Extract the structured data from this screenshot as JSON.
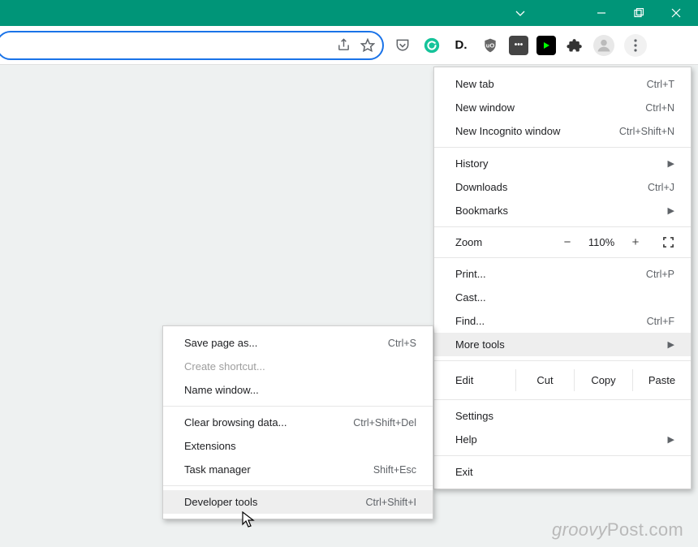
{
  "colors": {
    "accent": "#009578",
    "omnibox_border": "#1a73e8"
  },
  "menu": {
    "new_tab": "New tab",
    "new_tab_sc": "Ctrl+T",
    "new_window": "New window",
    "new_window_sc": "Ctrl+N",
    "new_incognito": "New Incognito window",
    "new_incognito_sc": "Ctrl+Shift+N",
    "history": "History",
    "downloads": "Downloads",
    "downloads_sc": "Ctrl+J",
    "bookmarks": "Bookmarks",
    "zoom": "Zoom",
    "zoom_value": "110%",
    "print": "Print...",
    "print_sc": "Ctrl+P",
    "cast": "Cast...",
    "find": "Find...",
    "find_sc": "Ctrl+F",
    "more_tools": "More tools",
    "edit": "Edit",
    "cut": "Cut",
    "copy": "Copy",
    "paste": "Paste",
    "settings": "Settings",
    "help": "Help",
    "exit": "Exit"
  },
  "submenu": {
    "save_page": "Save page as...",
    "save_page_sc": "Ctrl+S",
    "create_shortcut": "Create shortcut...",
    "name_window": "Name window...",
    "clear_data": "Clear browsing data...",
    "clear_data_sc": "Ctrl+Shift+Del",
    "extensions": "Extensions",
    "task_manager": "Task manager",
    "task_manager_sc": "Shift+Esc",
    "dev_tools": "Developer tools",
    "dev_tools_sc": "Ctrl+Shift+I"
  },
  "watermark": {
    "brand": "groovy",
    "suffix": "Post.com"
  },
  "icons": {
    "d_label": "D.",
    "ext_box": "•••"
  }
}
